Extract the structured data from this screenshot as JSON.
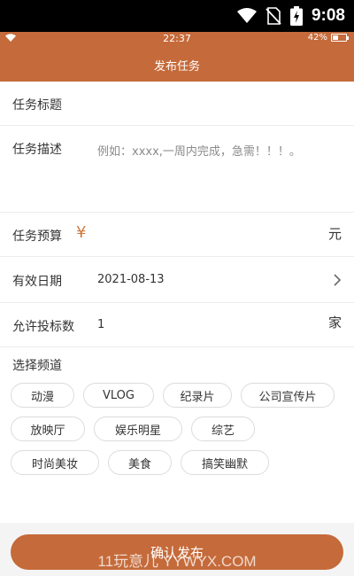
{
  "system_status": {
    "time": "9:08",
    "icons": [
      "wifi-icon",
      "no-sim-icon",
      "battery-charging-icon"
    ]
  },
  "app_status": {
    "time": "22:37",
    "battery_percent": "42%",
    "battery_level": 0.42
  },
  "header": {
    "title": "发布任务"
  },
  "form": {
    "title_label": "任务标题",
    "desc_label": "任务描述",
    "desc_placeholder": "例如：xxxx,一周内完成，急需！！！。",
    "budget_label": "任务预算",
    "currency_symbol": "¥",
    "budget_unit": "元",
    "date_label": "有效日期",
    "date_value": "2021-08-13",
    "bids_label": "允许投标数",
    "bids_value": "1",
    "bids_unit": "家"
  },
  "channels": {
    "title": "选择频道",
    "options": [
      "动漫",
      "VLOG",
      "纪录片",
      "公司宣传片",
      "放映厅",
      "娱乐明星",
      "综艺",
      "时尚美妆",
      "美食",
      "搞笑幽默"
    ]
  },
  "actions": {
    "confirm_label": "确认发布"
  },
  "watermark": "11玩意儿 YYWYX.COM",
  "colors": {
    "accent": "#c56a3a",
    "yen": "#d07a3e"
  }
}
